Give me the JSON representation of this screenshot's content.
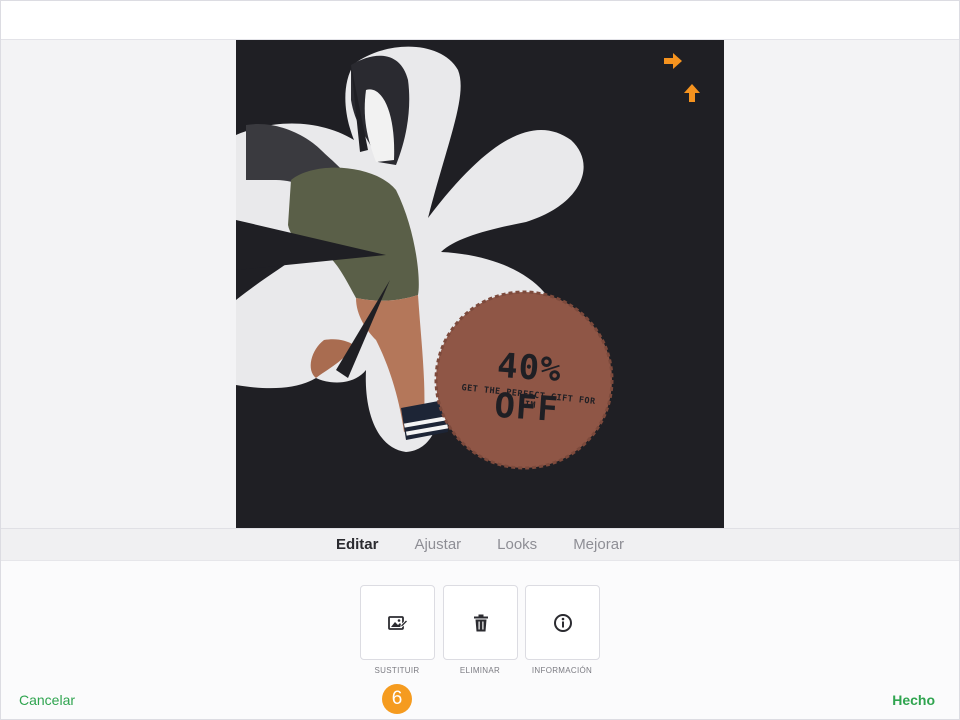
{
  "tabs": [
    {
      "label": "Editar"
    },
    {
      "label": "Ajustar"
    },
    {
      "label": "Looks"
    },
    {
      "label": "Mejorar"
    }
  ],
  "artwork": {
    "badge_title": "40% OFF",
    "badge_subtitle": "GET THE PERFECT GIFT FOR HIM",
    "badge_color": "#8f5646",
    "background_color": "#1f1f24",
    "flower_color": "#e9e9eb"
  },
  "tools": [
    {
      "icon": "replace-image-icon",
      "label": "SUSTITUIR"
    },
    {
      "icon": "trash-icon",
      "label": "ELIMINAR"
    },
    {
      "icon": "info-icon",
      "label": "INFORMACIÓN"
    }
  ],
  "footer": {
    "cancel_label": "Cancelar",
    "done_label": "Hecho",
    "step_number": "6"
  },
  "colors": {
    "accent_green": "#2fa44f",
    "handle_orange": "#f5931f"
  }
}
